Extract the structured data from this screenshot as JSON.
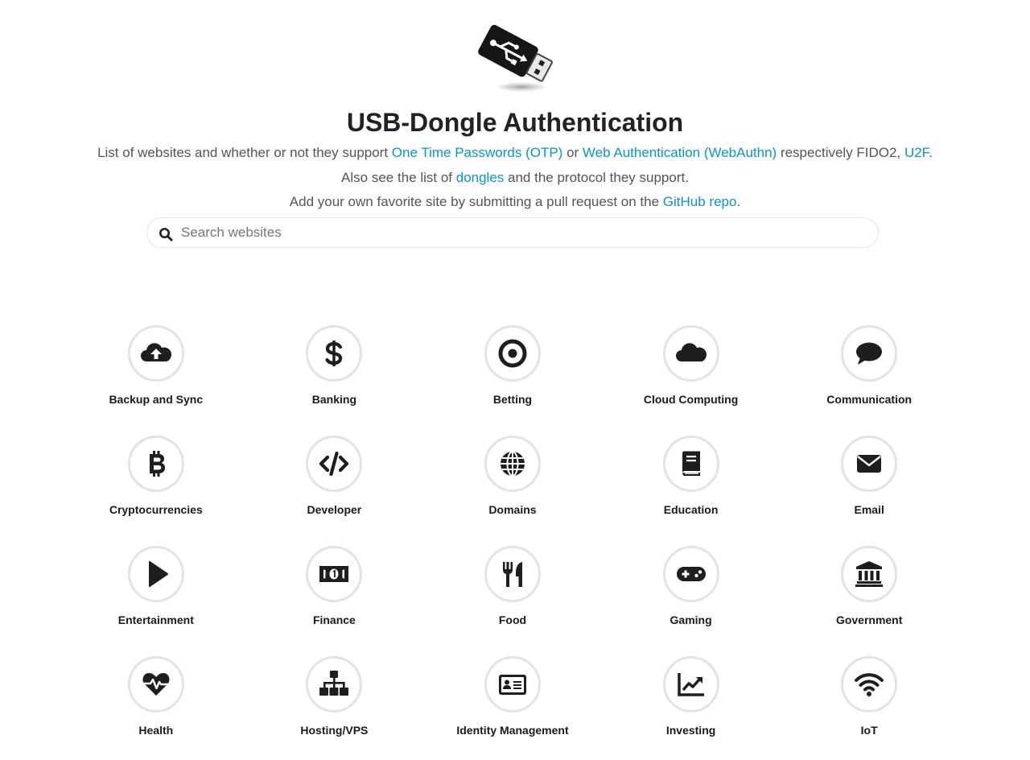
{
  "header": {
    "logo_icon": "usb-dongle-icon",
    "title": "USB-Dongle Authentication",
    "line1": {
      "text_before": "List of websites and whether or not they support ",
      "link_otp": "One Time Passwords (OTP)",
      "text_or": " or ",
      "link_webauthn": "Web Authentication (WebAuthn)",
      "text_respectively": " respectively FIDO2, ",
      "link_u2f": "U2F",
      "text_end": "."
    },
    "line2": {
      "text_before": "Also see the list of ",
      "link_dongles": "dongles",
      "text_after": " and the protocol they support."
    },
    "line3": {
      "text_before": "Add your own favorite site by submitting a pull request on the ",
      "link_github": "GitHub repo",
      "text_end": "."
    }
  },
  "search": {
    "placeholder": "Search websites",
    "value": "",
    "icon": "search-icon"
  },
  "colors": {
    "link": "#0a95c8",
    "icon": "#1e1e1e",
    "circle_border": "#e3e3e3"
  },
  "categories": [
    {
      "label": "Backup and Sync",
      "icon": "cloud-upload-icon"
    },
    {
      "label": "Banking",
      "icon": "dollar-icon"
    },
    {
      "label": "Betting",
      "icon": "target-icon"
    },
    {
      "label": "Cloud Computing",
      "icon": "cloud-icon"
    },
    {
      "label": "Communication",
      "icon": "speech-bubble-icon"
    },
    {
      "label": "Cryptocurrencies",
      "icon": "bitcoin-icon"
    },
    {
      "label": "Developer",
      "icon": "code-icon"
    },
    {
      "label": "Domains",
      "icon": "globe-icon"
    },
    {
      "label": "Education",
      "icon": "book-icon"
    },
    {
      "label": "Email",
      "icon": "envelope-icon"
    },
    {
      "label": "Entertainment",
      "icon": "play-icon"
    },
    {
      "label": "Finance",
      "icon": "banknote-icon"
    },
    {
      "label": "Food",
      "icon": "utensils-icon"
    },
    {
      "label": "Gaming",
      "icon": "gamepad-icon"
    },
    {
      "label": "Government",
      "icon": "landmark-icon"
    },
    {
      "label": "Health",
      "icon": "heartbeat-icon"
    },
    {
      "label": "Hosting/VPS",
      "icon": "sitemap-icon"
    },
    {
      "label": "Identity Management",
      "icon": "id-card-icon"
    },
    {
      "label": "Investing",
      "icon": "chart-line-icon"
    },
    {
      "label": "IoT",
      "icon": "wifi-icon"
    }
  ]
}
